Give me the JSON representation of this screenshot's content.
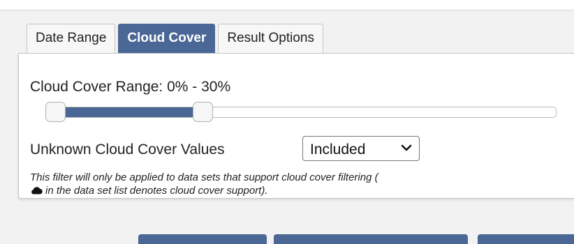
{
  "tabs": [
    {
      "label": "Date Range",
      "active": false
    },
    {
      "label": "Cloud Cover",
      "active": true
    },
    {
      "label": "Result Options",
      "active": false
    }
  ],
  "cloud_cover": {
    "range_label": "Cloud Cover Range: 0% - 30%",
    "slider": {
      "min": 0,
      "max": 100,
      "low": 0,
      "high": 30
    },
    "unknown_label": "Unknown Cloud Cover Values",
    "unknown_select": {
      "selected": "Included"
    },
    "note_line1": "This filter will only be applied to data sets that support cloud cover filtering (",
    "note_line2": "in the data set list denotes cloud cover support).",
    "note_icon": "cloud-icon"
  },
  "colors": {
    "accent": "#4a6796",
    "tab_inactive": "#f7f7f7",
    "panel_bg": "#ffffff",
    "page_bg": "#f2f2f2"
  },
  "icons": {
    "select": "chevron-down-icon",
    "note": "cloud-icon"
  }
}
